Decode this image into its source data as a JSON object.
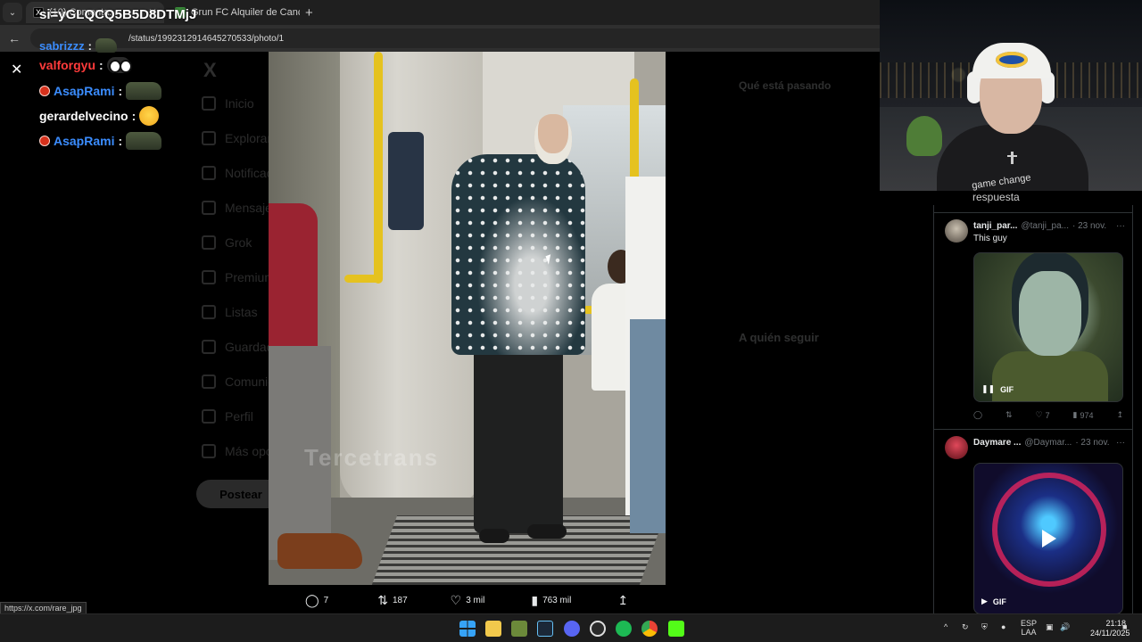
{
  "browser": {
    "tab1_title": "(10) Comenta...",
    "tab2_title": "Grun FC Alquiler de Canchas de",
    "overlay_title": "si=yGLQCQ5B5D8DTMjJ",
    "url": "/status/1992312914645270533/photo/1",
    "status_url": "https://x.com/rare_jpg"
  },
  "chat": {
    "messages": [
      {
        "user": "valforgyu",
        "color": "#ff3b3b",
        "emote": "eyes"
      },
      {
        "user": "AsapRami",
        "color": "#3b8dff",
        "emote": "frog",
        "badge": true
      },
      {
        "user": "gerardelvecino",
        "color": "#ffffff",
        "emote": "face"
      },
      {
        "user": "AsapRami",
        "color": "#3b8dff",
        "emote": "frog",
        "badge": true
      }
    ],
    "overlay_user": "sabrizzz",
    "overlay_color": "#3b8dff"
  },
  "x_sidebar": {
    "items": [
      "Inicio",
      "Explorar",
      "Notificaciones",
      "Mensajes",
      "Grok",
      "Premium",
      "Listas",
      "Guardados",
      "Comunidades",
      "Perfil",
      "Más opciones"
    ],
    "post_label": "Postear"
  },
  "x_right": {
    "header": "Qué está pasando",
    "follow_header": "A quién seguir"
  },
  "photo": {
    "watermark": "Tercetrans",
    "stats": {
      "replies": "7",
      "reposts": "187",
      "likes": "3 mil",
      "views": "763 mil"
    }
  },
  "webcam": {
    "shirt_text": "game change",
    "respuesta": "respuesta"
  },
  "feed": {
    "post1": {
      "name": "tanji_par...",
      "handle": "@tanji_pa...",
      "date": "· 23 nov.",
      "text": "This guy",
      "media_label": "GIF",
      "likes": "7",
      "views": "974"
    },
    "post2": {
      "name": "Daymare ...",
      "handle": "@Daymar...",
      "date": "· 23 nov.",
      "media_label": "GIF"
    }
  },
  "taskbar": {
    "lang1": "ESP",
    "lang2": "LAA",
    "time": "21:18",
    "date": "24/11/2025"
  },
  "colors": {
    "x_accent": "#1d9bf0",
    "chat_red": "#ff3b3b",
    "chat_blue": "#3b8dff"
  }
}
